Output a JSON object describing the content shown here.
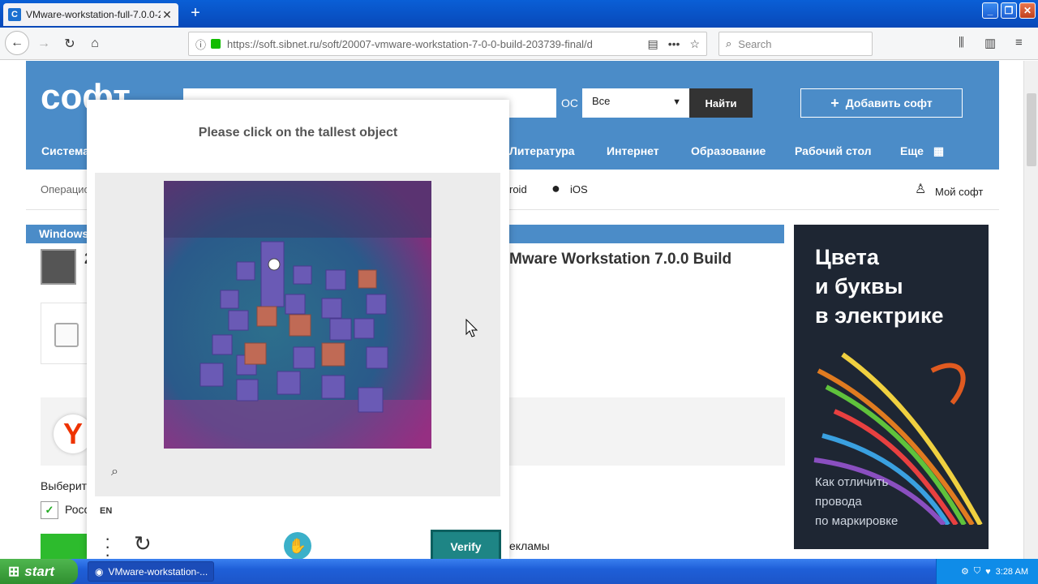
{
  "browser": {
    "tab_title": "VMware-workstation-full-7.0.0-2c",
    "tab_favicon": "C",
    "url": "https://soft.sibnet.ru/soft/20007-vmware-workstation-7-0-0-build-203739-final/d",
    "search_placeholder": "Search"
  },
  "site": {
    "logo": "софт",
    "os_label": "ОС",
    "os_select": "Все",
    "find_button": "Найти",
    "add_button": "Добавить софт",
    "categories": [
      "Система",
      "Литература",
      "Интернет",
      "Образование",
      "Рабочий стол",
      "Еще"
    ],
    "subnav": [
      "Операцио",
      "roid",
      "iOS",
      "Мой софт"
    ],
    "section_label": "Windows",
    "page_title": "Mware Workstation 7.0.0 Build",
    "page_title_line2": "2",
    "choose_label": "Выберит",
    "russia_label": "Росс",
    "ads_text": "екламы"
  },
  "ad": {
    "headline": "Цвета\nи буквы\nв электрике",
    "subtext": "Как отличить\nпровода\nпо маркировке"
  },
  "captcha": {
    "prompt": "Please click on the tallest object",
    "language": "EN",
    "verify_label": "Verify",
    "accent_color": "#1e8585"
  },
  "taskbar": {
    "start_label": "start",
    "task_label": "VMware-workstation-...",
    "clock": "3:28 AM"
  }
}
